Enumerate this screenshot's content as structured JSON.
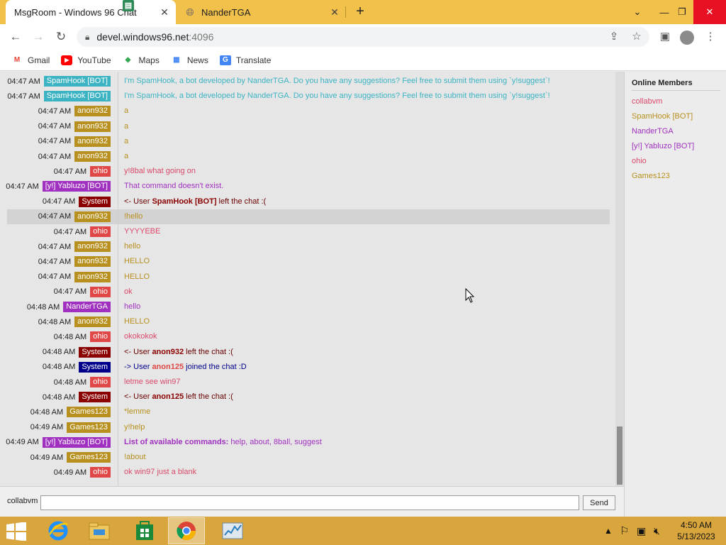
{
  "browser": {
    "tabs": [
      {
        "title": "MsgRoom - Windows 96 Chat",
        "active": true
      },
      {
        "title": "NanderTGA",
        "active": false
      }
    ],
    "url_host": "devel.windows96.net",
    "url_port": ":4096",
    "bookmarks": [
      "Gmail",
      "YouTube",
      "Maps",
      "News",
      "Translate"
    ]
  },
  "chat": {
    "messages": [
      {
        "time": "04:47 AM",
        "user": "SpamHook [BOT]",
        "user_color": "#3bb3c3",
        "text": "I'm SpamHook, a bot developed by NanderTGA. Do you have any suggestions? Feel free to submit them using `y!suggest`!",
        "text_color": "#3bb3c3"
      },
      {
        "time": "04:47 AM",
        "user": "SpamHook [BOT]",
        "user_color": "#3bb3c3",
        "text": "I'm SpamHook, a bot developed by NanderTGA. Do you have any suggestions? Feel free to submit them using `y!suggest`!",
        "text_color": "#3bb3c3"
      },
      {
        "time": "04:47 AM",
        "user": "anon932",
        "user_color": "#b8901f",
        "text": "a",
        "text_color": "#b8901f"
      },
      {
        "time": "04:47 AM",
        "user": "anon932",
        "user_color": "#b8901f",
        "text": "a",
        "text_color": "#b8901f"
      },
      {
        "time": "04:47 AM",
        "user": "anon932",
        "user_color": "#b8901f",
        "text": "a",
        "text_color": "#b8901f"
      },
      {
        "time": "04:47 AM",
        "user": "anon932",
        "user_color": "#b8901f",
        "text": "a",
        "text_color": "#b8901f"
      },
      {
        "time": "04:47 AM",
        "user": "ohio",
        "user_color": "#e04848",
        "text": "y!8bal what going on",
        "text_color": "#d94a6a"
      },
      {
        "time": "04:47 AM",
        "user": "[y!] Yabluzo [BOT]",
        "user_color": "#a030c0",
        "text": "That command doesn't exist.",
        "text_color": "#a030c0"
      },
      {
        "time": "04:47 AM",
        "user": "System",
        "user_color": "#8b0000",
        "sys_prefix": "<- User ",
        "sys_user": "SpamHook [BOT]",
        "sys_user_color": "#8b0000",
        "sys_suffix": " left the chat :(",
        "text_color": "#6a0000"
      },
      {
        "time": "04:47 AM",
        "user": "anon932",
        "user_color": "#b8901f",
        "text": "!hello",
        "text_color": "#b8901f",
        "highlight": true
      },
      {
        "time": "04:47 AM",
        "user": "ohio",
        "user_color": "#e04848",
        "text": "YYYYEBE",
        "text_color": "#d94a6a"
      },
      {
        "time": "04:47 AM",
        "user": "anon932",
        "user_color": "#b8901f",
        "text": "hello",
        "text_color": "#b8901f"
      },
      {
        "time": "04:47 AM",
        "user": "anon932",
        "user_color": "#b8901f",
        "text": "HELLO",
        "text_color": "#b8901f"
      },
      {
        "time": "04:47 AM",
        "user": "anon932",
        "user_color": "#b8901f",
        "text": "HELLO",
        "text_color": "#b8901f"
      },
      {
        "time": "04:47 AM",
        "user": "ohio",
        "user_color": "#e04848",
        "text": "ok",
        "text_color": "#d94a6a"
      },
      {
        "time": "04:48 AM",
        "user": "NanderTGA",
        "user_color": "#a030c0",
        "text": "hello",
        "text_color": "#a030c0"
      },
      {
        "time": "04:48 AM",
        "user": "anon932",
        "user_color": "#b8901f",
        "text": "HELLO",
        "text_color": "#b8901f"
      },
      {
        "time": "04:48 AM",
        "user": "ohio",
        "user_color": "#e04848",
        "text": "okokokok",
        "text_color": "#d94a6a"
      },
      {
        "time": "04:48 AM",
        "user": "System",
        "user_color": "#8b0000",
        "sys_prefix": "<- User ",
        "sys_user": "anon932",
        "sys_user_color": "#8b0000",
        "sys_suffix": " left the chat :(",
        "text_color": "#6a0000"
      },
      {
        "time": "04:48 AM",
        "user": "System",
        "user_color": "#00008b",
        "sys_prefix": "-> User ",
        "sys_user": "anon125",
        "sys_user_color": "#e04848",
        "sys_suffix": " joined the chat :D",
        "text_color": "#00008b"
      },
      {
        "time": "04:48 AM",
        "user": "ohio",
        "user_color": "#e04848",
        "text": "letme see win97",
        "text_color": "#d94a6a"
      },
      {
        "time": "04:48 AM",
        "user": "System",
        "user_color": "#8b0000",
        "sys_prefix": "<- User ",
        "sys_user": "anon125",
        "sys_user_color": "#8b0000",
        "sys_suffix": " left the chat :(",
        "text_color": "#6a0000"
      },
      {
        "time": "04:48 AM",
        "user": "Games123",
        "user_color": "#b8901f",
        "text": "*lemme",
        "text_color": "#b8901f"
      },
      {
        "time": "04:49 AM",
        "user": "Games123",
        "user_color": "#b8901f",
        "text": "y!help",
        "text_color": "#b8901f"
      },
      {
        "time": "04:49 AM",
        "user": "[y!] Yabluzo [BOT]",
        "user_color": "#a030c0",
        "bold_prefix": "List of available commands:",
        "text": " help, about, 8ball, suggest",
        "text_color": "#a030c0"
      },
      {
        "time": "04:49 AM",
        "user": "Games123",
        "user_color": "#b8901f",
        "text": "!about",
        "text_color": "#b8901f"
      },
      {
        "time": "04:49 AM",
        "user": "ohio",
        "user_color": "#e04848",
        "text": "ok win97 just a blank",
        "text_color": "#d94a6a"
      }
    ],
    "online_title": "Online Members",
    "members": [
      {
        "name": "collabvm",
        "color": "#d94a6a"
      },
      {
        "name": "SpamHook [BOT]",
        "color": "#b8901f"
      },
      {
        "name": "NanderTGA",
        "color": "#a030c0"
      },
      {
        "name": "[y!] Yabluzo [BOT]",
        "color": "#a030c0"
      },
      {
        "name": "ohio",
        "color": "#d94a6a"
      },
      {
        "name": "Games123",
        "color": "#b8901f"
      }
    ],
    "current_user": "collabvm",
    "input_value": "",
    "send_label": "Send"
  },
  "taskbar": {
    "time": "4:50 AM",
    "date": "5/13/2023"
  },
  "icons": {
    "back": "back-arrow-icon",
    "forward": "forward-arrow-icon",
    "reload": "reload-icon",
    "lock": "lock-icon"
  }
}
